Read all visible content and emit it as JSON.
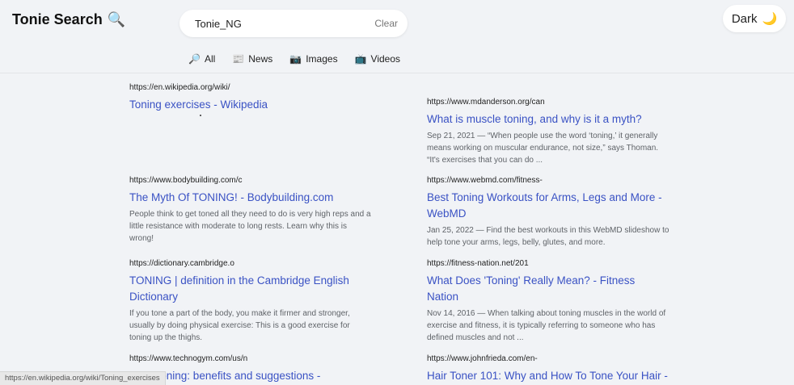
{
  "app": {
    "title": "Tonie Search",
    "title_icon": "magnifier"
  },
  "search": {
    "value": "Tonie_NG",
    "placeholder": "",
    "clear_label": "Clear"
  },
  "theme_toggle": {
    "label": "Dark",
    "icon": "crescent-moon"
  },
  "tabs": [
    {
      "label": "All",
      "icon": "magnifier"
    },
    {
      "label": "News",
      "icon": "news"
    },
    {
      "label": "Images",
      "icon": "camera"
    },
    {
      "label": "Videos",
      "icon": "tv"
    }
  ],
  "results": [
    {
      "url": "https://en.wikipedia.org/wiki/",
      "title": "Toning exercises - Wikipedia",
      "snippet": ""
    },
    {
      "url": "https://www.mdanderson.org/can",
      "title": "What is muscle toning, and why is it a myth?",
      "snippet": "Sep 21, 2021 — “When people use the word ‘toning,’ it generally means working on muscular endurance, not size,” says Thoman. “It's exercises that you can do ..."
    },
    {
      "url": "https://www.bodybuilding.com/c",
      "title": "The Myth Of TONING! - Bodybuilding.com",
      "snippet": "People think to get toned all they need to do is very high reps and a little resistance with moderate to long rests. Learn why this is wrong!"
    },
    {
      "url": "https://www.webmd.com/fitness-",
      "title": "Best Toning Workouts for Arms, Legs and More - WebMD",
      "snippet": "Jan 25, 2022 — Find the best workouts in this WebMD slideshow to help tone your arms, legs, belly, glutes, and more."
    },
    {
      "url": "https://dictionary.cambridge.o",
      "title": "TONING | definition in the Cambridge English Dictionary",
      "snippet": "If you tone a part of the body, you make it firmer and stronger, usually by doing physical exercise: This is a good exercise for toning up the thighs."
    },
    {
      "url": "https://fitness-nation.net/201",
      "title": "What Does 'Toning' Really Mean? - Fitness Nation",
      "snippet": "Nov 14, 2016 — When talking about toning muscles in the world of exercise and fitness, it is typically referring to someone who has defined muscles and not ..."
    },
    {
      "url": "https://www.technogym.com/us/n",
      "title": "Body toning: benefits and suggestions -",
      "snippet": ""
    },
    {
      "url": "https://www.johnfrieda.com/en-",
      "title": "Hair Toner 101: Why and How To Tone Your Hair -",
      "snippet": ""
    }
  ],
  "status_bar": {
    "text": "https://en.wikipedia.org/wiki/Toning_exercises"
  }
}
